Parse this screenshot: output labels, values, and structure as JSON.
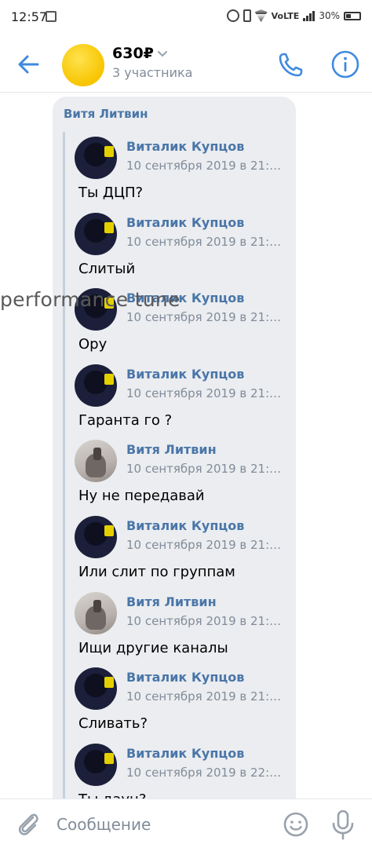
{
  "status_bar": {
    "time": "12:57",
    "network": "VoLTE",
    "battery": "30%"
  },
  "header": {
    "title": "630₽",
    "subtitle": "3 участника"
  },
  "bubble": {
    "author": "Витя Литвин",
    "forwarded": [
      {
        "author": "Виталик Купцов",
        "date": "10 сентября 2019 в 21:…",
        "text": "Ты ДЦП?",
        "avatar": "dark"
      },
      {
        "author": "Виталик Купцов",
        "date": "10 сентября 2019 в 21:…",
        "text": "Слитый",
        "avatar": "dark"
      },
      {
        "author": "Виталик Купцов",
        "date": "10 сентября 2019 в 21:…",
        "text": "Ору",
        "avatar": "dark"
      },
      {
        "author": "Виталик Купцов",
        "date": "10 сентября 2019 в 21:…",
        "text": "Гаранта го ?",
        "avatar": "dark"
      },
      {
        "author": "Витя Литвин",
        "date": "10 сентября 2019 в 21:…",
        "text": "Ну не передавай",
        "avatar": "light"
      },
      {
        "author": "Виталик Купцов",
        "date": "10 сентября 2019 в 21:…",
        "text": "Или слит по группам",
        "avatar": "dark"
      },
      {
        "author": "Витя Литвин",
        "date": "10 сентября 2019 в 21:…",
        "text": "Ищи другие каналы",
        "avatar": "light"
      },
      {
        "author": "Виталик Купцов",
        "date": "10 сентября 2019 в 21:…",
        "text": "Сливать?",
        "avatar": "dark"
      },
      {
        "author": "Виталик Купцов",
        "date": "10 сентября 2019 в 22:…",
        "text": "Ты даун?",
        "avatar": "dark"
      }
    ]
  },
  "watermark": "performance tune",
  "composer": {
    "placeholder": "Сообщение"
  },
  "colors": {
    "accent": "#4a76a8",
    "icon_blue": "#3f8ae0",
    "bubble_bg": "#ebedf0",
    "secondary_text": "#818c99"
  },
  "icons": [
    "back-arrow-icon",
    "chevron-down-icon",
    "phone-icon",
    "info-icon",
    "chevron-down-scroll-icon",
    "paperclip-icon",
    "emoji-icon",
    "microphone-icon"
  ]
}
